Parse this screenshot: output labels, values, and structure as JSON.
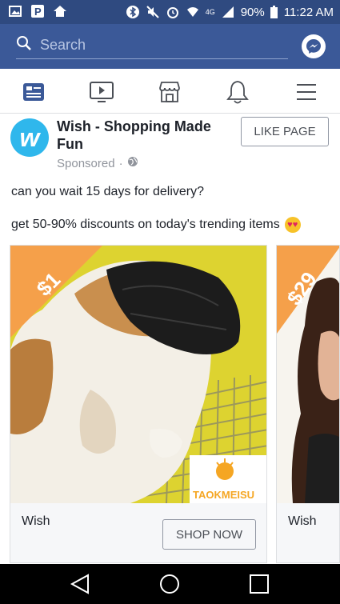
{
  "status_bar": {
    "battery": "90%",
    "time": "11:22 AM",
    "network": "4G"
  },
  "search": {
    "placeholder": "Search"
  },
  "post": {
    "page_name": "Wish - Shopping Made Fun",
    "sponsored": "Sponsored",
    "like_button": "LIKE PAGE",
    "text_line1": "can you wait 15 days for delivery?",
    "text_line2": "get 50-90% discounts on today's trending items",
    "avatar_letter": "w"
  },
  "cards": [
    {
      "price": "$1",
      "title": "Wish",
      "button": "SHOP NOW",
      "watermark": "TAOKMEISU"
    },
    {
      "price": "$29",
      "title": "Wish"
    }
  ],
  "colors": {
    "facebook_blue": "#3b5998",
    "status_blue": "#2f4a80",
    "wish_blue": "#2fb7ec",
    "price_orange": "#f5a04a"
  }
}
